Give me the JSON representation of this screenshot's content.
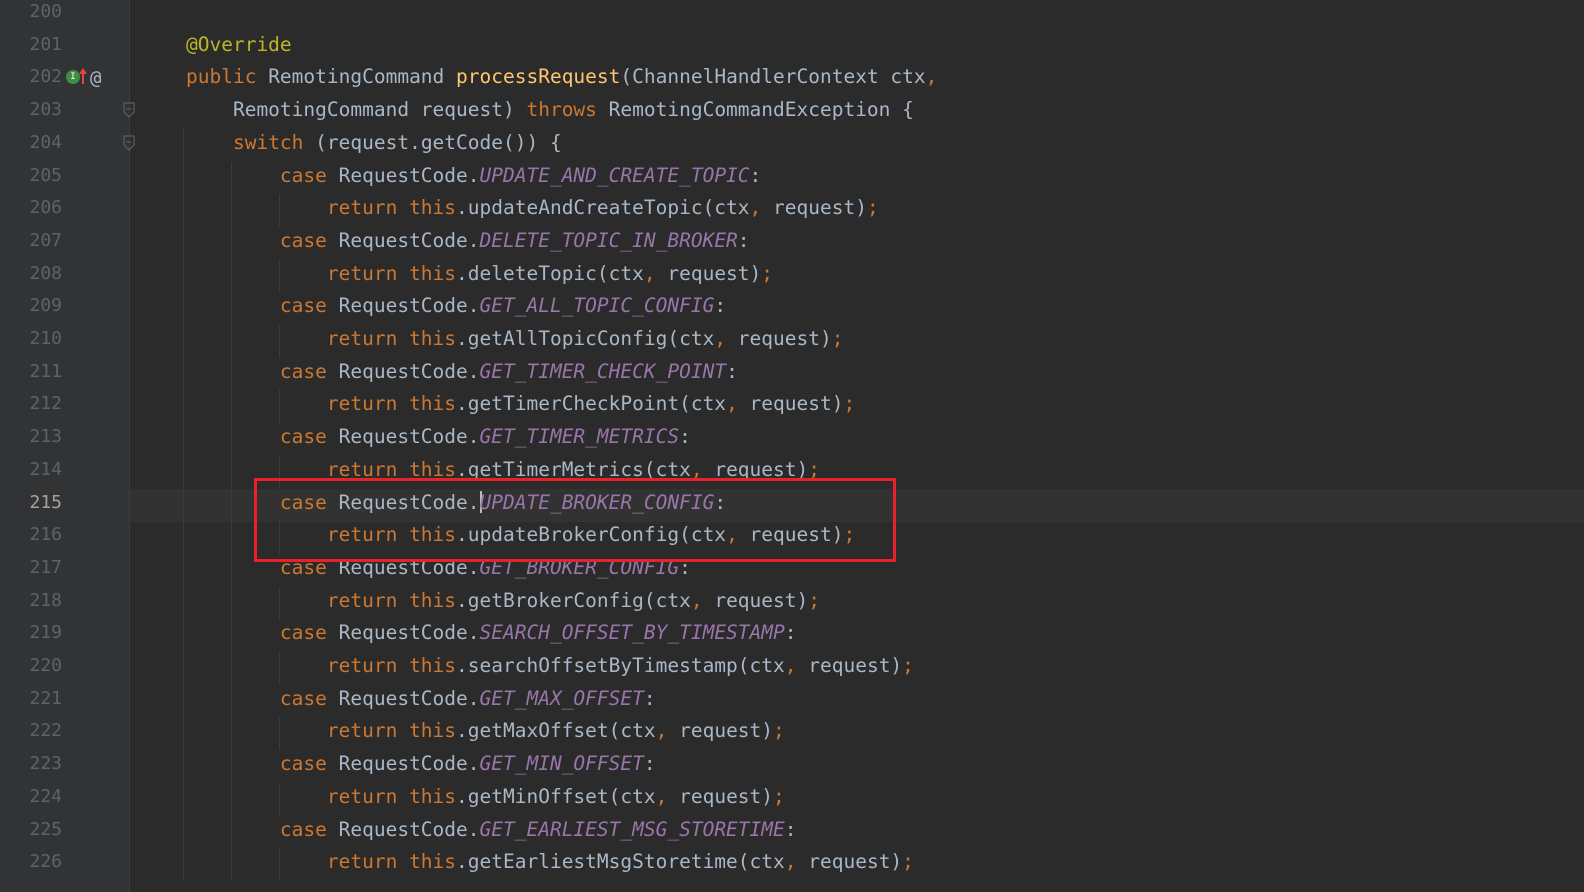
{
  "gutter": {
    "line_numbers": [
      "200",
      "201",
      "202",
      "203",
      "204",
      "205",
      "206",
      "207",
      "208",
      "209",
      "210",
      "211",
      "212",
      "213",
      "214",
      "215",
      "216",
      "217",
      "218",
      "219",
      "220",
      "221",
      "222",
      "223",
      "224",
      "225",
      "226"
    ],
    "current_line_index": 15,
    "impl_icon_letter": "I"
  },
  "colors": {
    "background": "#2b2b2b",
    "gutter": "#313335",
    "default_text": "#a9b7c6",
    "keyword": "#cc7832",
    "annotation": "#bbb529",
    "method_declaration": "#ffc66d",
    "static_constant": "#9876aa",
    "line_number": "#606366",
    "highlight_box": "#e8212b"
  },
  "lines": [
    [],
    [
      [
        "ann",
        "@Override"
      ]
    ],
    [
      [
        "kw",
        "public "
      ],
      [
        "txt",
        "RemotingCommand "
      ],
      [
        "fn",
        "processRequest"
      ],
      [
        "txt",
        "(ChannelHandlerContext ctx"
      ],
      [
        "punc",
        ","
      ]
    ],
    [
      [
        "txt",
        "    RemotingCommand request) "
      ],
      [
        "kw",
        "throws "
      ],
      [
        "txt",
        "RemotingCommandException {"
      ]
    ],
    [
      [
        "txt",
        "    "
      ],
      [
        "kw",
        "switch "
      ],
      [
        "txt",
        "(request.getCode()) {"
      ]
    ],
    [
      [
        "txt",
        "        "
      ],
      [
        "kw",
        "case "
      ],
      [
        "txt",
        "RequestCode."
      ],
      [
        "cst",
        "UPDATE_AND_CREATE_TOPIC"
      ],
      [
        "txt",
        ":"
      ]
    ],
    [
      [
        "txt",
        "            "
      ],
      [
        "kw",
        "return this"
      ],
      [
        "txt",
        ".updateAndCreateTopic(ctx"
      ],
      [
        "punc",
        ", "
      ],
      [
        "txt",
        "request)"
      ],
      [
        "punc",
        ";"
      ]
    ],
    [
      [
        "txt",
        "        "
      ],
      [
        "kw",
        "case "
      ],
      [
        "txt",
        "RequestCode."
      ],
      [
        "cst",
        "DELETE_TOPIC_IN_BROKER"
      ],
      [
        "txt",
        ":"
      ]
    ],
    [
      [
        "txt",
        "            "
      ],
      [
        "kw",
        "return this"
      ],
      [
        "txt",
        ".deleteTopic(ctx"
      ],
      [
        "punc",
        ", "
      ],
      [
        "txt",
        "request)"
      ],
      [
        "punc",
        ";"
      ]
    ],
    [
      [
        "txt",
        "        "
      ],
      [
        "kw",
        "case "
      ],
      [
        "txt",
        "RequestCode."
      ],
      [
        "cst",
        "GET_ALL_TOPIC_CONFIG"
      ],
      [
        "txt",
        ":"
      ]
    ],
    [
      [
        "txt",
        "            "
      ],
      [
        "kw",
        "return this"
      ],
      [
        "txt",
        ".getAllTopicConfig(ctx"
      ],
      [
        "punc",
        ", "
      ],
      [
        "txt",
        "request)"
      ],
      [
        "punc",
        ";"
      ]
    ],
    [
      [
        "txt",
        "        "
      ],
      [
        "kw",
        "case "
      ],
      [
        "txt",
        "RequestCode."
      ],
      [
        "cst",
        "GET_TIMER_CHECK_POINT"
      ],
      [
        "txt",
        ":"
      ]
    ],
    [
      [
        "txt",
        "            "
      ],
      [
        "kw",
        "return this"
      ],
      [
        "txt",
        ".getTimerCheckPoint(ctx"
      ],
      [
        "punc",
        ", "
      ],
      [
        "txt",
        "request)"
      ],
      [
        "punc",
        ";"
      ]
    ],
    [
      [
        "txt",
        "        "
      ],
      [
        "kw",
        "case "
      ],
      [
        "txt",
        "RequestCode."
      ],
      [
        "cst",
        "GET_TIMER_METRICS"
      ],
      [
        "txt",
        ":"
      ]
    ],
    [
      [
        "txt",
        "            "
      ],
      [
        "kw",
        "return this"
      ],
      [
        "txt",
        ".getTimerMetrics(ctx"
      ],
      [
        "punc",
        ", "
      ],
      [
        "txt",
        "request)"
      ],
      [
        "punc",
        ";"
      ]
    ],
    [
      [
        "txt",
        "        "
      ],
      [
        "kw",
        "case "
      ],
      [
        "txt",
        "RequestCode."
      ],
      [
        "caret",
        ""
      ],
      [
        "cst",
        "UPDATE_BROKER_CONFIG"
      ],
      [
        "txt",
        ":"
      ]
    ],
    [
      [
        "txt",
        "            "
      ],
      [
        "kw",
        "return this"
      ],
      [
        "txt",
        ".updateBrokerConfig(ctx"
      ],
      [
        "punc",
        ", "
      ],
      [
        "txt",
        "request)"
      ],
      [
        "punc",
        ";"
      ]
    ],
    [
      [
        "txt",
        "        "
      ],
      [
        "kw",
        "case "
      ],
      [
        "txt",
        "RequestCode."
      ],
      [
        "cst",
        "GET_BROKER_CONFIG"
      ],
      [
        "txt",
        ":"
      ]
    ],
    [
      [
        "txt",
        "            "
      ],
      [
        "kw",
        "return this"
      ],
      [
        "txt",
        ".getBrokerConfig(ctx"
      ],
      [
        "punc",
        ", "
      ],
      [
        "txt",
        "request)"
      ],
      [
        "punc",
        ";"
      ]
    ],
    [
      [
        "txt",
        "        "
      ],
      [
        "kw",
        "case "
      ],
      [
        "txt",
        "RequestCode."
      ],
      [
        "cst",
        "SEARCH_OFFSET_BY_TIMESTAMP"
      ],
      [
        "txt",
        ":"
      ]
    ],
    [
      [
        "txt",
        "            "
      ],
      [
        "kw",
        "return this"
      ],
      [
        "txt",
        ".searchOffsetByTimestamp(ctx"
      ],
      [
        "punc",
        ", "
      ],
      [
        "txt",
        "request)"
      ],
      [
        "punc",
        ";"
      ]
    ],
    [
      [
        "txt",
        "        "
      ],
      [
        "kw",
        "case "
      ],
      [
        "txt",
        "RequestCode."
      ],
      [
        "cst",
        "GET_MAX_OFFSET"
      ],
      [
        "txt",
        ":"
      ]
    ],
    [
      [
        "txt",
        "            "
      ],
      [
        "kw",
        "return this"
      ],
      [
        "txt",
        ".getMaxOffset(ctx"
      ],
      [
        "punc",
        ", "
      ],
      [
        "txt",
        "request)"
      ],
      [
        "punc",
        ";"
      ]
    ],
    [
      [
        "txt",
        "        "
      ],
      [
        "kw",
        "case "
      ],
      [
        "txt",
        "RequestCode."
      ],
      [
        "cst",
        "GET_MIN_OFFSET"
      ],
      [
        "txt",
        ":"
      ]
    ],
    [
      [
        "txt",
        "            "
      ],
      [
        "kw",
        "return this"
      ],
      [
        "txt",
        ".getMinOffset(ctx"
      ],
      [
        "punc",
        ", "
      ],
      [
        "txt",
        "request)"
      ],
      [
        "punc",
        ";"
      ]
    ],
    [
      [
        "txt",
        "        "
      ],
      [
        "kw",
        "case "
      ],
      [
        "txt",
        "RequestCode."
      ],
      [
        "cst",
        "GET_EARLIEST_MSG_STORETIME"
      ],
      [
        "txt",
        ":"
      ]
    ],
    [
      [
        "txt",
        "            "
      ],
      [
        "kw",
        "return this"
      ],
      [
        "txt",
        ".getEarliestMsgStoretime(ctx"
      ],
      [
        "punc",
        ", "
      ],
      [
        "txt",
        "request)"
      ],
      [
        "punc",
        ";"
      ]
    ]
  ]
}
